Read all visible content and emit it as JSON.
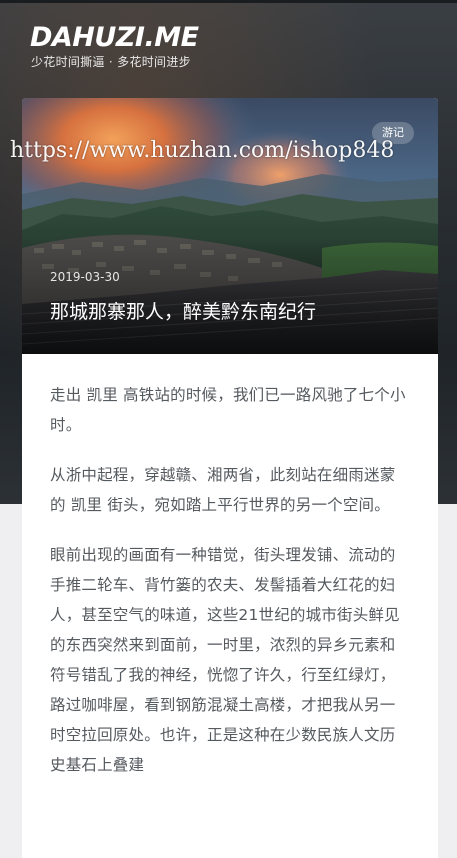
{
  "site": {
    "logo": "DAHUZI.ME",
    "tagline": "少花时间撕逼 · 多花时间进步"
  },
  "watermark": "https://www.huzhan.com/ishop848",
  "post": {
    "category": "游记",
    "date": "2019-03-30",
    "title": "那城那寨那人，醉美黔东南纪行",
    "paragraphs": [
      "走出 凯里 高铁站的时候，我们已一路风驰了七个小时。",
      "从浙中起程，穿越赣、湘两省，此刻站在细雨迷蒙的 凯里 街头，宛如踏上平行世界的另一个空间。",
      "眼前出现的画面有一种错觉，街头理发铺、流动的手推二轮车、背竹篓的农夫、发髻插着大红花的妇人，甚至空气的味道，这些21世纪的城市街头鲜见的东西突然来到面前，一时里，浓烈的异乡元素和符号错乱了我的神经，恍惚了许久，行至红绿灯，路过咖啡屋，看到钢筋混凝土高楼，才把我从另一时空拉回原处。也许，正是这种在少数民族人文历史基石上叠建"
    ]
  }
}
